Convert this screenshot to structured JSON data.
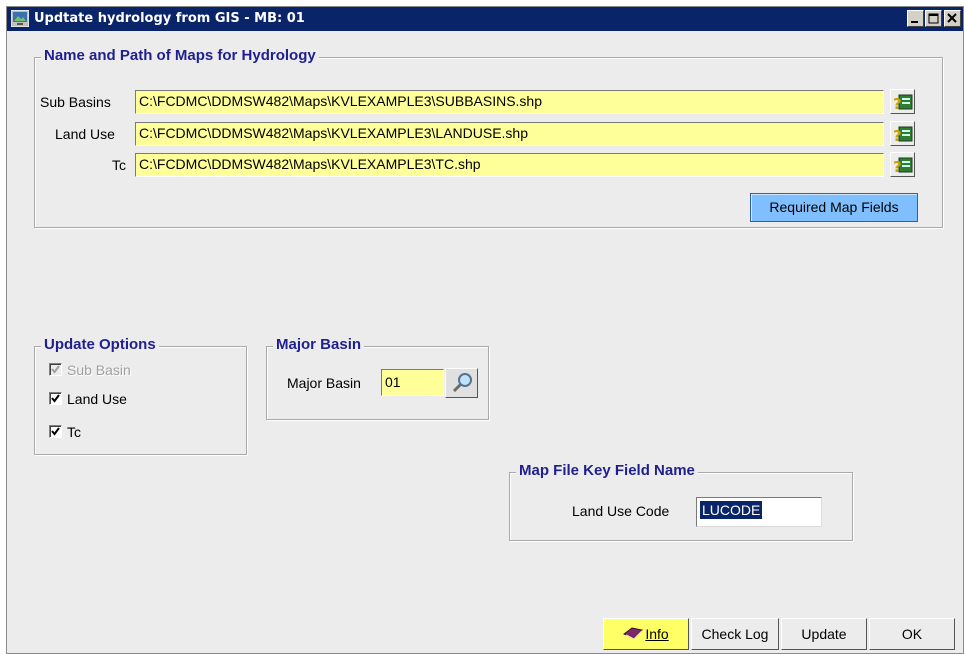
{
  "window": {
    "title": "Updtate hydrology from GIS - MB: 01",
    "titlebar_color": "#0a246a"
  },
  "maps_group": {
    "title": "Name and Path of Maps for Hydrology",
    "rows": [
      {
        "label": "Sub Basins",
        "value": "C:\\FCDMC\\DDMSW482\\Maps\\KVLEXAMPLE3\\SUBBASINS.shp"
      },
      {
        "label": "Land Use",
        "value": "C:\\FCDMC\\DDMSW482\\Maps\\KVLEXAMPLE3\\LANDUSE.shp"
      },
      {
        "label": "Tc",
        "value": "C:\\FCDMC\\DDMSW482\\Maps\\KVLEXAMPLE3\\TC.shp"
      }
    ],
    "required_fields_button": "Required Map Fields",
    "field_color": "#ffff99"
  },
  "update_options": {
    "title": "Update Options",
    "items": [
      {
        "label": "Sub Basin",
        "checked": true,
        "enabled": false
      },
      {
        "label": "Land Use",
        "checked": true,
        "enabled": true
      },
      {
        "label": "Tc",
        "checked": true,
        "enabled": true
      }
    ]
  },
  "major_basin": {
    "title": "Major Basin",
    "label": "Major Basin",
    "value": "01"
  },
  "key_field": {
    "title": "Map File Key Field Name",
    "label": "Land Use Code",
    "value": "LUCODE"
  },
  "buttons": {
    "info": "Info",
    "check_log": "Check Log",
    "update": "Update",
    "ok": "OK"
  }
}
